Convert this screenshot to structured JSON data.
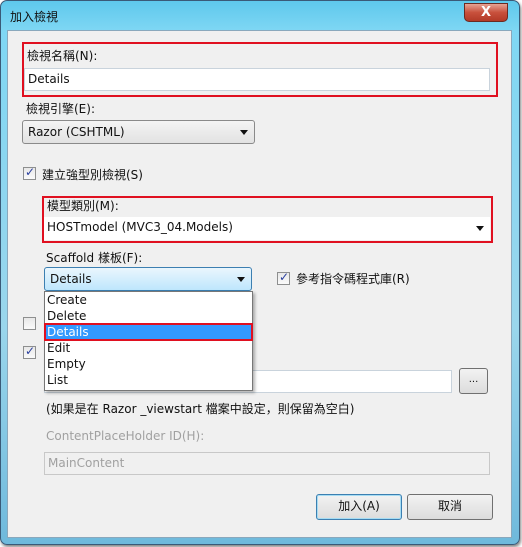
{
  "window": {
    "title": "加入檢視",
    "close_glyph": "X"
  },
  "view_name": {
    "label": "檢視名稱(N):",
    "value": "Details"
  },
  "view_engine": {
    "label": "檢視引擎(E):",
    "value": "Razor (CSHTML)"
  },
  "strongly_typed": {
    "label": "建立強型別檢視(S)",
    "checked": true
  },
  "model_class": {
    "label": "模型類別(M):",
    "value": "HOSTmodel (MVC3_04.Models)"
  },
  "scaffold": {
    "label": "Scaffold 樣板(F):",
    "value": "Details",
    "options": [
      "Create",
      "Delete",
      "Details",
      "Edit",
      "Empty",
      "List"
    ],
    "selected_index": 2
  },
  "reference_scripts": {
    "label": "參考指令碼程式庫(R)",
    "checked": true
  },
  "partial_view": {
    "checked": false
  },
  "use_layout": {
    "checked": true
  },
  "layout": {
    "browse_label": "...",
    "hint": "(如果是在 Razor _viewstart 檔案中設定，則保留為空白)"
  },
  "content_placeholder": {
    "label": "ContentPlaceHolder ID(H):",
    "value": "MainContent"
  },
  "buttons": {
    "add": "加入(A)",
    "cancel": "取消"
  },
  "colors": {
    "highlight": "#e01020",
    "selection": "#3399ff"
  }
}
